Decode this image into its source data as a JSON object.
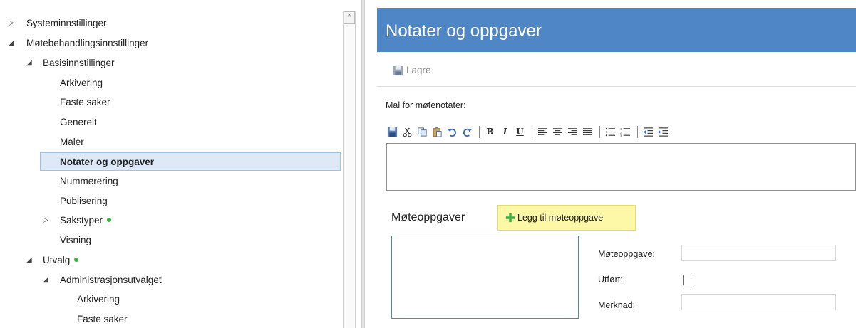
{
  "tree": {
    "items": [
      {
        "label": "Systeminnstillinger",
        "toggle": "▷",
        "dot": false
      },
      {
        "label": "Møtebehandlingsinnstillinger",
        "toggle": "◢",
        "dot": false
      },
      {
        "label": "Basisinnstillinger",
        "toggle": "◢",
        "dot": false
      },
      {
        "label": "Arkivering",
        "toggle": "",
        "dot": false
      },
      {
        "label": "Faste saker",
        "toggle": "",
        "dot": false
      },
      {
        "label": "Generelt",
        "toggle": "",
        "dot": false
      },
      {
        "label": "Maler",
        "toggle": "",
        "dot": false
      },
      {
        "label": "Notater og oppgaver",
        "toggle": "",
        "dot": false,
        "selected": true
      },
      {
        "label": "Nummerering",
        "toggle": "",
        "dot": false
      },
      {
        "label": "Publisering",
        "toggle": "",
        "dot": false
      },
      {
        "label": "Sakstyper",
        "toggle": "▷",
        "dot": true
      },
      {
        "label": "Visning",
        "toggle": "",
        "dot": false
      },
      {
        "label": "Utvalg",
        "toggle": "◢",
        "dot": true
      },
      {
        "label": "Administrasjonsutvalget",
        "toggle": "◢",
        "dot": false
      },
      {
        "label": "Arkivering",
        "toggle": "",
        "dot": false
      },
      {
        "label": "Faste saker",
        "toggle": "",
        "dot": false
      }
    ]
  },
  "scrollbar": {
    "up_arrow": "^"
  },
  "header": {
    "title": "Notater og oppgaver"
  },
  "toolbar": {
    "save_label": "Lagre"
  },
  "notes": {
    "label": "Mal for møtenotater:"
  },
  "editor_toolbar": {
    "bold": "B",
    "italic": "I",
    "underline": "U"
  },
  "tasks": {
    "label": "Møteoppgaver",
    "add_button": "Legg til møteoppgave"
  },
  "form": {
    "task_label": "Møteoppgave:",
    "done_label": "Utført:",
    "note_label": "Merknad:",
    "task_value": "",
    "note_value": ""
  },
  "colors": {
    "header_bg": "#4f86c6",
    "selected_bg": "#dde9f7",
    "status_dot": "#3cb043",
    "add_button_bg": "#fcf8a8"
  }
}
